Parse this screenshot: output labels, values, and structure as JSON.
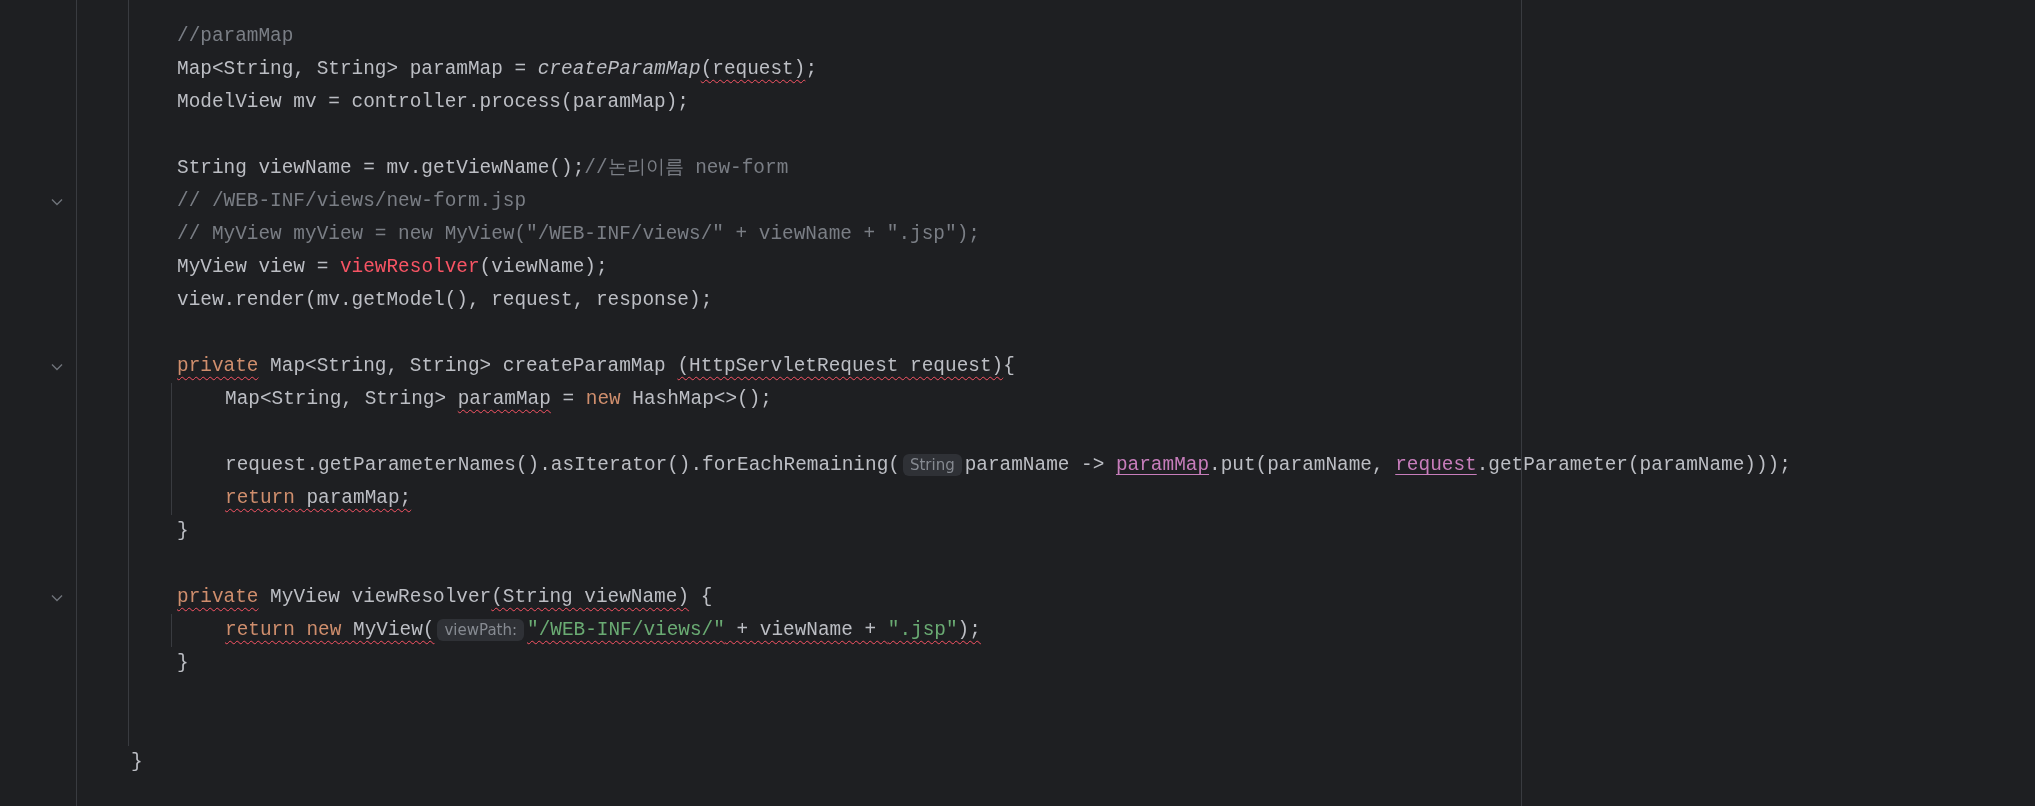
{
  "editor": {
    "lines": [
      {
        "kind": "code",
        "fold": false,
        "tokens": [
          {
            "text": "//paramMap",
            "kind": "comment",
            "error": false
          }
        ]
      },
      {
        "kind": "code",
        "fold": false,
        "tokens": [
          {
            "text": "Map<String, String> paramMap = ",
            "kind": "plain",
            "error": false
          },
          {
            "text": "createParamMap",
            "kind": "call",
            "error": false
          },
          {
            "text": "(request)",
            "kind": "plain",
            "error": true
          },
          {
            "text": ";",
            "kind": "plain",
            "error": false
          }
        ]
      },
      {
        "kind": "code",
        "fold": false,
        "tokens": [
          {
            "text": "ModelView mv = controller.process(paramMap);",
            "kind": "plain",
            "error": false
          }
        ]
      },
      {
        "kind": "blank",
        "fold": false
      },
      {
        "kind": "code",
        "fold": false,
        "tokens": [
          {
            "text": "String viewName = mv.getViewName();",
            "kind": "plain",
            "error": false
          },
          {
            "text": "//논리이름 new-form",
            "kind": "comment",
            "error": false
          }
        ]
      },
      {
        "kind": "code",
        "fold": true,
        "tokens": [
          {
            "text": "// /WEB-INF/views/new-form.jsp",
            "kind": "comment",
            "error": false
          }
        ]
      },
      {
        "kind": "code",
        "fold": false,
        "tokens": [
          {
            "text": "// MyView myView = new MyView(\"/WEB-INF/views/\" + viewName + \".jsp\");",
            "kind": "comment",
            "error": false
          }
        ]
      },
      {
        "kind": "code",
        "fold": false,
        "tokens": [
          {
            "text": "MyView view = ",
            "kind": "plain",
            "error": false
          },
          {
            "text": "viewResolver",
            "kind": "unresolved",
            "error": false
          },
          {
            "text": "(viewName);",
            "kind": "plain",
            "error": false
          }
        ]
      },
      {
        "kind": "code",
        "fold": false,
        "tokens": [
          {
            "text": "view.render(mv.getModel(), request, response);",
            "kind": "plain",
            "error": false
          }
        ]
      },
      {
        "kind": "blank",
        "fold": false
      },
      {
        "kind": "code",
        "fold": true,
        "tokens": [
          {
            "text": "private",
            "kind": "keyword",
            "error": true
          },
          {
            "text": " Map<String, String> createParamMap ",
            "kind": "plain",
            "error": false
          },
          {
            "text": "(HttpServletRequest request)",
            "kind": "plain",
            "error": true
          },
          {
            "text": "{",
            "kind": "plain",
            "error": false
          }
        ],
        "children": [
          {
            "kind": "code",
            "fold": false,
            "tokens": [
              {
                "text": "Map<String, String> ",
                "kind": "plain",
                "error": false
              },
              {
                "text": "paramMap",
                "kind": "plain",
                "error": true
              },
              {
                "text": " = ",
                "kind": "plain",
                "error": false
              },
              {
                "text": "new",
                "kind": "keyword",
                "error": false
              },
              {
                "text": " HashMap<>();",
                "kind": "plain",
                "error": false
              }
            ]
          },
          {
            "kind": "blank",
            "fold": false
          },
          {
            "kind": "code",
            "fold": false,
            "tokens": [
              {
                "text": "request.getParameterNames().asIterator().forEachRemaining(",
                "kind": "plain",
                "error": false
              },
              {
                "text": "String",
                "kind": "hint",
                "error": false
              },
              {
                "text": "paramName -> ",
                "kind": "plain",
                "error": false
              },
              {
                "text": "paramMap",
                "kind": "field",
                "error": false
              },
              {
                "text": ".put(paramName, ",
                "kind": "plain",
                "error": false
              },
              {
                "text": "request",
                "kind": "field",
                "error": false
              },
              {
                "text": ".getParameter(paramName)));",
                "kind": "plain",
                "error": false
              }
            ]
          },
          {
            "kind": "code",
            "fold": false,
            "tokens": [
              {
                "text": "return",
                "kind": "keyword",
                "error": true
              },
              {
                "text": " paramMap;",
                "kind": "plain",
                "error": true
              }
            ]
          }
        ]
      },
      {
        "kind": "code",
        "fold": false,
        "tokens": [
          {
            "text": "}",
            "kind": "plain",
            "error": false
          }
        ]
      },
      {
        "kind": "blank",
        "fold": false
      },
      {
        "kind": "code",
        "fold": true,
        "tokens": [
          {
            "text": "private",
            "kind": "keyword",
            "error": true
          },
          {
            "text": " MyView viewResolver",
            "kind": "plain",
            "error": false
          },
          {
            "text": "(String viewName)",
            "kind": "plain",
            "error": true
          },
          {
            "text": " {",
            "kind": "plain",
            "error": false
          }
        ],
        "children": [
          {
            "kind": "code",
            "fold": false,
            "tokens": [
              {
                "text": "return new",
                "kind": "keyword",
                "error": true
              },
              {
                "text": " MyView(",
                "kind": "plain",
                "error": true
              },
              {
                "text": "viewPath:",
                "kind": "hint",
                "error": false
              },
              {
                "text": "\"/WEB-INF/views/\"",
                "kind": "string",
                "error": true
              },
              {
                "text": " + viewName + ",
                "kind": "plain",
                "error": true
              },
              {
                "text": "\".jsp\"",
                "kind": "string",
                "error": true
              },
              {
                "text": ");",
                "kind": "plain",
                "error": true
              }
            ]
          }
        ]
      },
      {
        "kind": "code",
        "fold": false,
        "tokens": [
          {
            "text": "}",
            "kind": "plain",
            "error": false
          }
        ]
      },
      {
        "kind": "blank",
        "fold": false
      },
      {
        "kind": "blank",
        "fold": false
      }
    ],
    "closing": {
      "tokens": [
        {
          "text": "}",
          "kind": "plain",
          "error": false
        }
      ]
    }
  }
}
